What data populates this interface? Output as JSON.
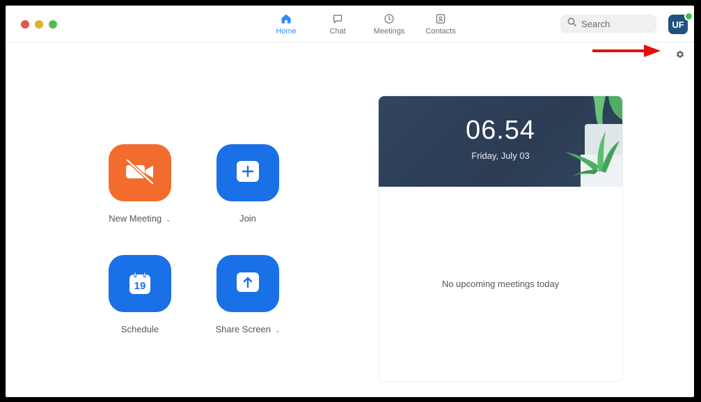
{
  "window": {
    "traffic_lights": [
      "close",
      "minimize",
      "maximize"
    ],
    "colors": {
      "close": "#e2564e",
      "minimize": "#e2b12a",
      "maximize": "#57bb50"
    }
  },
  "nav": {
    "tabs": [
      {
        "label": "Home",
        "icon": "home-icon",
        "active": true
      },
      {
        "label": "Chat",
        "icon": "chat-icon",
        "active": false
      },
      {
        "label": "Meetings",
        "icon": "clock-icon",
        "active": false
      },
      {
        "label": "Contacts",
        "icon": "contacts-icon",
        "active": false
      }
    ],
    "accent_color": "#2d8cff"
  },
  "search": {
    "placeholder": "Search",
    "icon": "search-icon"
  },
  "user": {
    "initials": "UF",
    "status": "online",
    "status_color": "#3ec34b"
  },
  "settings": {
    "icon": "gear-icon"
  },
  "annotation": {
    "icon": "red-arrow-icon",
    "color": "#e0100c"
  },
  "actions": [
    {
      "label": "New Meeting",
      "icon": "video-off-icon",
      "color": "#f26d2d",
      "has_dropdown": true
    },
    {
      "label": "Join",
      "icon": "plus-icon",
      "color": "#1a70e6",
      "has_dropdown": false
    },
    {
      "label": "Schedule",
      "icon": "calendar-icon",
      "calendar_day": "19",
      "color": "#1a70e6",
      "has_dropdown": false
    },
    {
      "label": "Share Screen",
      "icon": "share-up-arrow-icon",
      "color": "#1a70e6",
      "has_dropdown": true
    }
  ],
  "calendar_card": {
    "time": "06.54",
    "date": "Friday, July 03",
    "empty_message": "No upcoming meetings today",
    "decoration_icon": "plant-icon"
  }
}
